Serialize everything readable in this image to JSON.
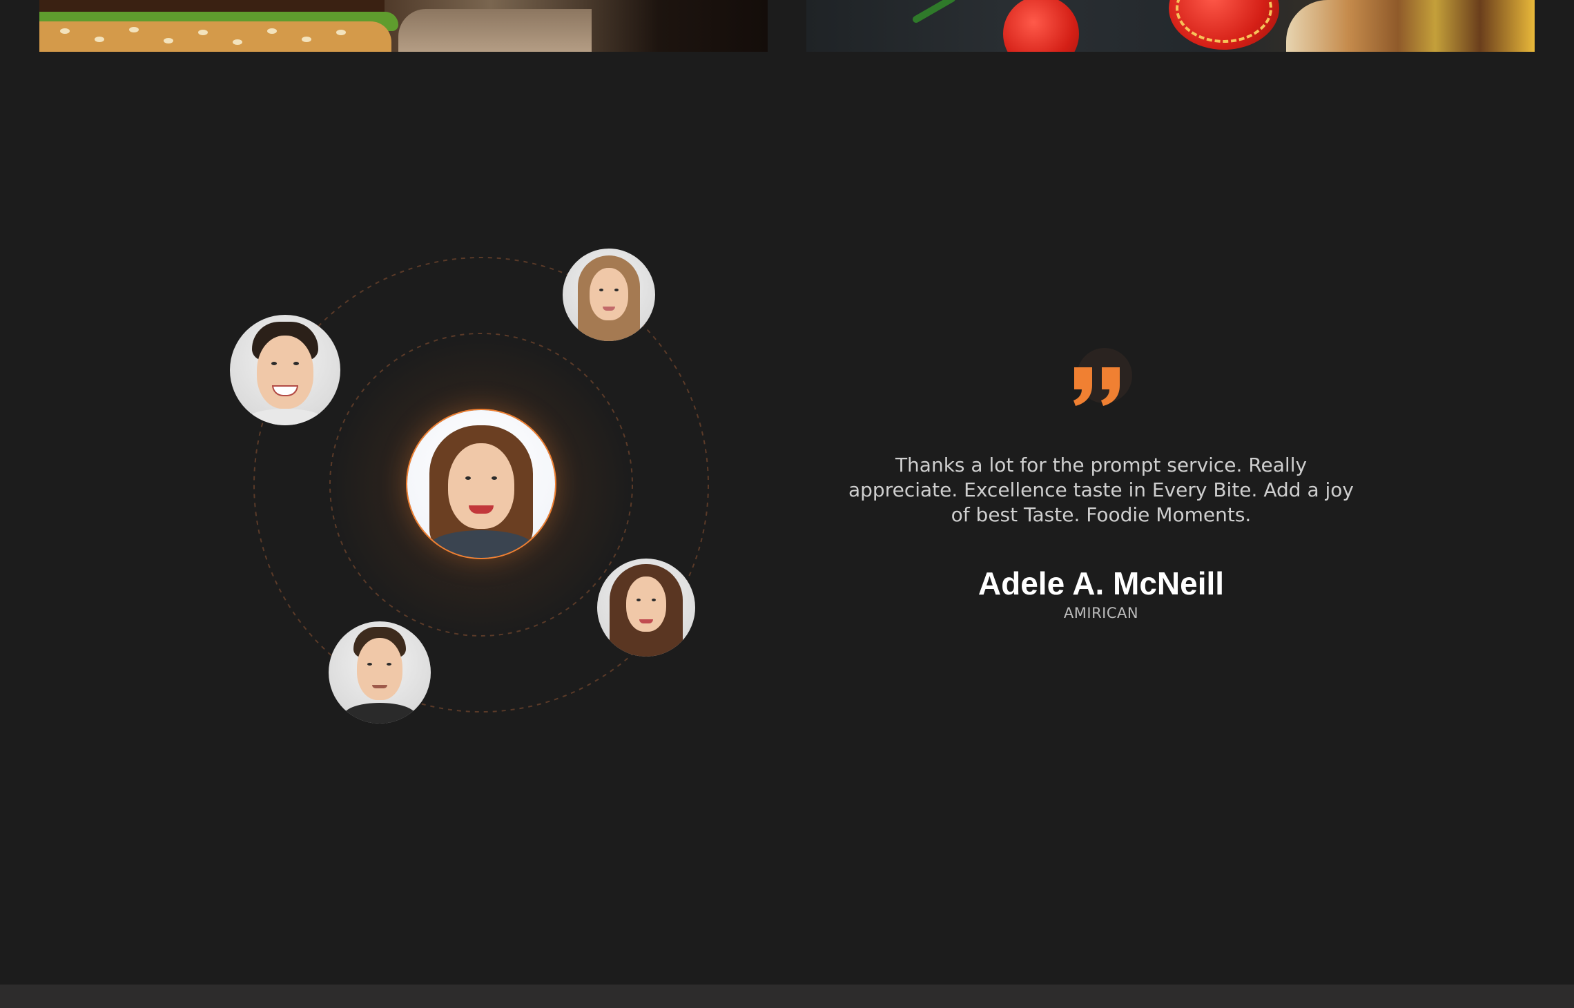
{
  "banners": {
    "left": {
      "icon": "burger-image"
    },
    "right": {
      "icon": "tomato-wrap-image"
    }
  },
  "colors": {
    "page_background": "#1c1c1c",
    "accent": "#f08032",
    "orbit_line": "#5a3a28",
    "text_light": "#cfcfcf",
    "heading": "#ffffff"
  },
  "testimonial": {
    "quote_icon": "quote-icon",
    "text": "Thanks a lot for the prompt service. Really appreciate. Excellence taste in Every Bite. Add a joy of best Taste. Foodie Moments.",
    "author_name": "Adele A. McNeill",
    "author_role": "AMIRICAN"
  },
  "customers": [
    {
      "name": "avatar-main-woman"
    },
    {
      "name": "avatar-man-top-left"
    },
    {
      "name": "avatar-woman-top-right"
    },
    {
      "name": "avatar-woman-bottom-right"
    },
    {
      "name": "avatar-man-bottom-left"
    }
  ]
}
